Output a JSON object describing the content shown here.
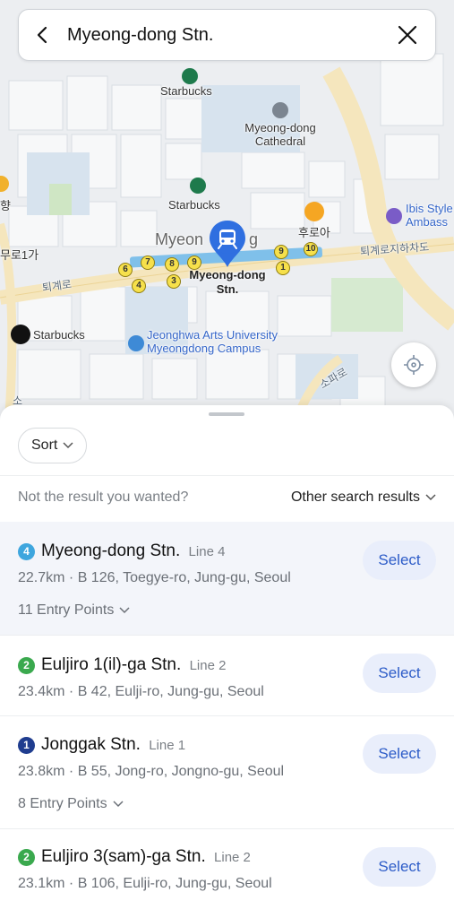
{
  "search": {
    "query": "Myeong-dong Stn.",
    "back_icon": "chevron-left-icon",
    "clear_icon": "close-icon"
  },
  "map": {
    "labels": {
      "starbucks_top": "Starbucks",
      "cathedral": "Myeong-dong Cathedral",
      "starbucks_mid": "Starbucks",
      "hyang": "향",
      "ibis": "Ibis Style Ambass",
      "huroa": "후로아",
      "myeongdong_area": "Myeon",
      "myeongdong_area_end": "g",
      "road_right": "퇴계로지하차도",
      "road_left": "퇴계로",
      "muro": "무로1가",
      "station": "Myeong-dong Stn.",
      "starbucks_reserve": "Starbucks",
      "jeonghwa": "Jeonghwa Arts University Myeongdong Campus",
      "sopa": "소파로",
      "so": "소"
    },
    "exits": [
      "1",
      "3",
      "4",
      "5",
      "6",
      "7",
      "8",
      "9",
      "10"
    ],
    "locate_icon": "crosshair-icon",
    "pin_icon": "subway-train-icon"
  },
  "sheet": {
    "sort_label": "Sort",
    "not_wanted": "Not the result you wanted?",
    "other_results": "Other search results"
  },
  "results": [
    {
      "line_number": "4",
      "line_color": "#3ea6de",
      "name": "Myeong-dong Stn.",
      "line_label": "Line 4",
      "meta": "22.7km · B 126, Toegye-ro, Jung-gu, Seoul",
      "entry_points": "11 Entry Points",
      "select": "Select"
    },
    {
      "line_number": "2",
      "line_color": "#3aa94e",
      "name": "Euljiro 1(il)-ga Stn.",
      "line_label": "Line 2",
      "meta": "23.4km · B 42, Eulji-ro, Jung-gu, Seoul",
      "entry_points": "",
      "select": "Select"
    },
    {
      "line_number": "1",
      "line_color": "#1f3d8f",
      "name": "Jonggak Stn.",
      "line_label": "Line 1",
      "meta": "23.8km · B 55, Jong-ro, Jongno-gu, Seoul",
      "entry_points": "8 Entry Points",
      "select": "Select"
    },
    {
      "line_number": "2",
      "line_color": "#3aa94e",
      "name": "Euljiro 3(sam)-ga Stn.",
      "line_label": "Line 2",
      "meta": "23.1km · B 106, Eulji-ro, Jung-gu, Seoul",
      "entry_points": "",
      "select": "Select"
    }
  ]
}
